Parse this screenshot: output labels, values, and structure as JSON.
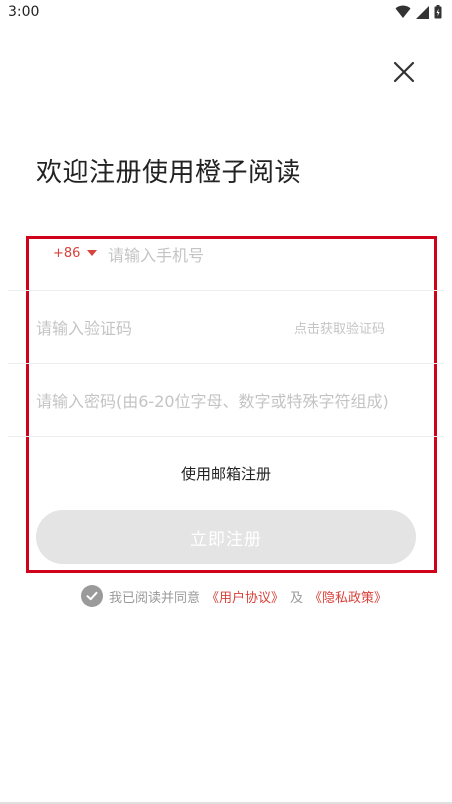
{
  "status_bar": {
    "time": "3:00"
  },
  "title": "欢迎注册使用橙子阅读",
  "form": {
    "country_code": "+86",
    "phone_placeholder": "请输入手机号",
    "code_placeholder": "请输入验证码",
    "get_code_label": "点击获取验证码",
    "password_placeholder": "请输入密码(由6-20位字母、数字或特殊字符组成)",
    "email_register_label": "使用邮箱注册",
    "submit_label": "立即注册"
  },
  "agreement": {
    "prefix": "我已阅读并同意",
    "user_agreement": "《用户协议》",
    "conjunction": "及",
    "privacy_policy": "《隐私政策》"
  },
  "colors": {
    "accent": "#d9413a",
    "highlight_box": "#d0021b",
    "button_disabled": "#e4e4e4",
    "placeholder": "#c4c4c4"
  },
  "icons": [
    "wifi-icon",
    "signal-icon",
    "battery-icon",
    "close-icon",
    "chevron-down-icon",
    "check-icon"
  ]
}
